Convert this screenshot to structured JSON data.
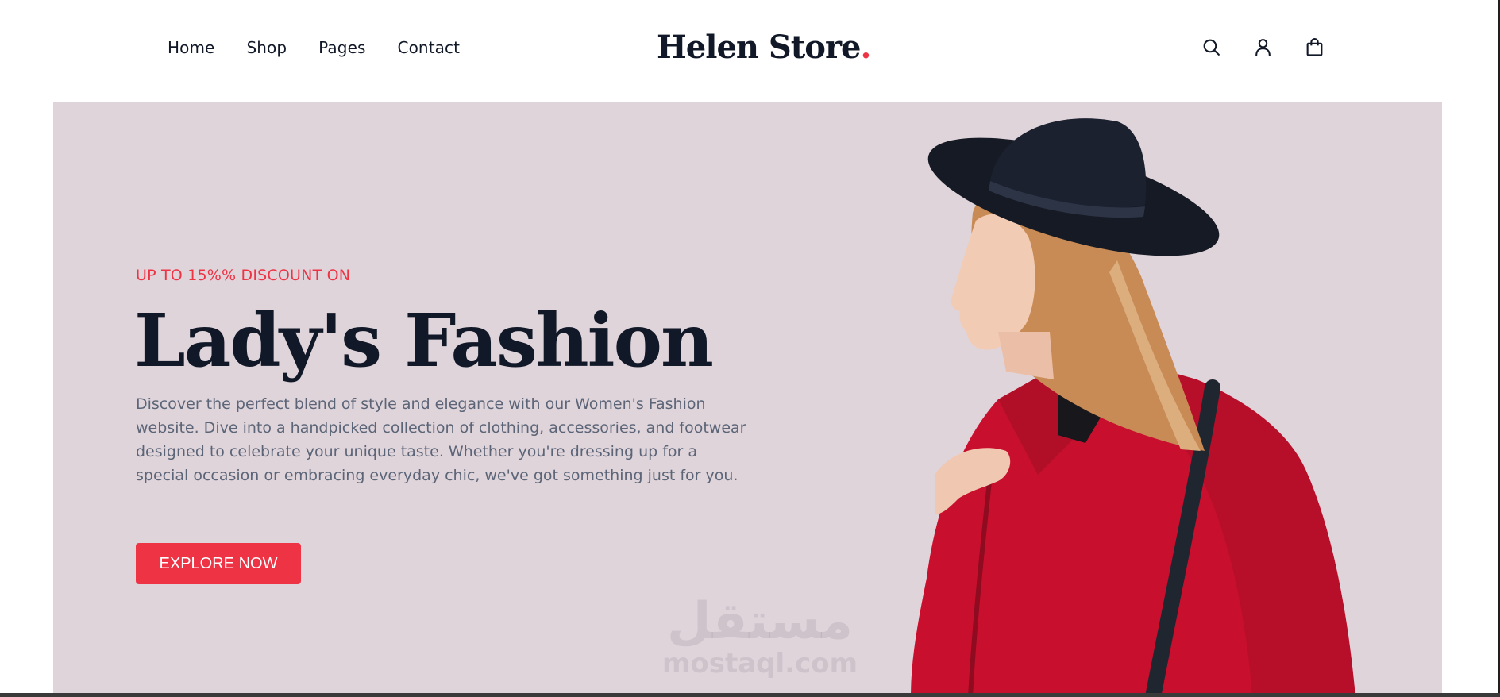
{
  "header": {
    "nav": [
      "Home",
      "Shop",
      "Pages",
      "Contact"
    ],
    "logo_text": "Helen Store",
    "logo_dot": ".",
    "icons": [
      "search-icon",
      "user-icon",
      "shopping-bag-icon"
    ]
  },
  "hero": {
    "eyebrow": "UP TO 15%% DISCOUNT ON",
    "headline": "Lady's Fashion",
    "description": "Discover the perfect blend of style and elegance with our Women's Fashion website. Dive into a handpicked collection of clothing, accessories, and footwear designed to celebrate your unique taste. Whether you're dressing up for a special occasion or embracing everyday chic, we've got something just for you.",
    "cta_label": "EXPLORE NOW"
  },
  "watermark": {
    "arabic": "مستقل",
    "latin": "mostaql.com"
  },
  "colors": {
    "accent": "#ee3345",
    "heading": "#111827",
    "hero_bg": "#e0d4db",
    "body_text": "#5b6577"
  }
}
